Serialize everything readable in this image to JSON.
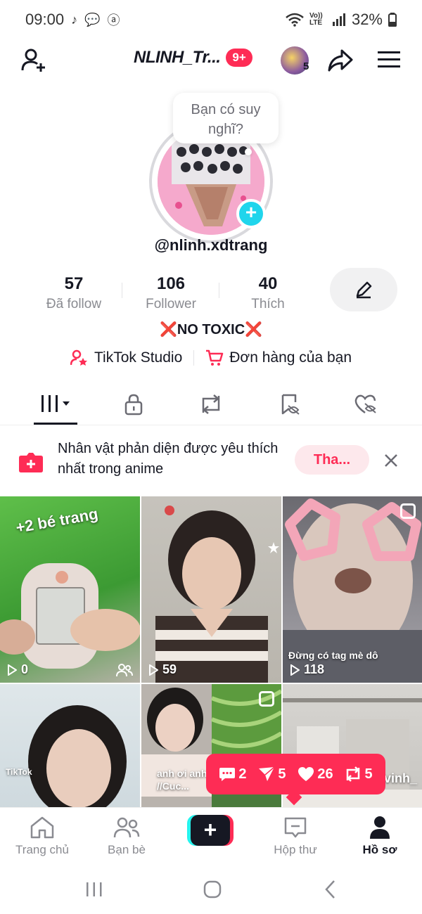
{
  "status_bar": {
    "time": "09:00",
    "battery": "32%",
    "network_label": "Vo)) LTE"
  },
  "header": {
    "title": "NLINH_Tr...",
    "notification_count": "9+",
    "friends_count": "5"
  },
  "profile": {
    "thought_bubble": "Bạn có suy nghĩ?",
    "username": "@nlinh.xdtrang",
    "stats": [
      {
        "value": "57",
        "label": "Đã follow"
      },
      {
        "value": "106",
        "label": "Follower"
      },
      {
        "value": "40",
        "label": "Thích"
      }
    ],
    "bio_mark_left": "❌",
    "bio_text": "NO TOXIC",
    "bio_mark_right": "❌",
    "links": {
      "studio": "TikTok Studio",
      "orders": "Đơn hàng của bạn"
    }
  },
  "tabs": [
    "videos",
    "private",
    "reposts",
    "favorites",
    "liked"
  ],
  "banner": {
    "text": "Nhân vật phản diện được yêu thích nhất trong anime",
    "button": "Tha..."
  },
  "videos": [
    {
      "views": "0",
      "caption": "+2 bé trang"
    },
    {
      "views": "59"
    },
    {
      "views": "118",
      "caption": "Đừng có tag mè dô"
    },
    {
      "caption": "TikTok"
    },
    {
      "caption": "anh ơi anh //Cuc..."
    },
    {
      "caption": "vinh_"
    }
  ],
  "notification": {
    "comments": "2",
    "shares": "5",
    "likes": "26",
    "reposts": "5"
  },
  "bottom_nav": {
    "home": "Trang chủ",
    "friends": "Bạn bè",
    "inbox": "Hộp thư",
    "profile": "Hồ sơ"
  },
  "colors": {
    "accent": "#fe2c55",
    "cyan": "#25f4ee",
    "text": "#161823",
    "muted": "#8a8b91"
  }
}
